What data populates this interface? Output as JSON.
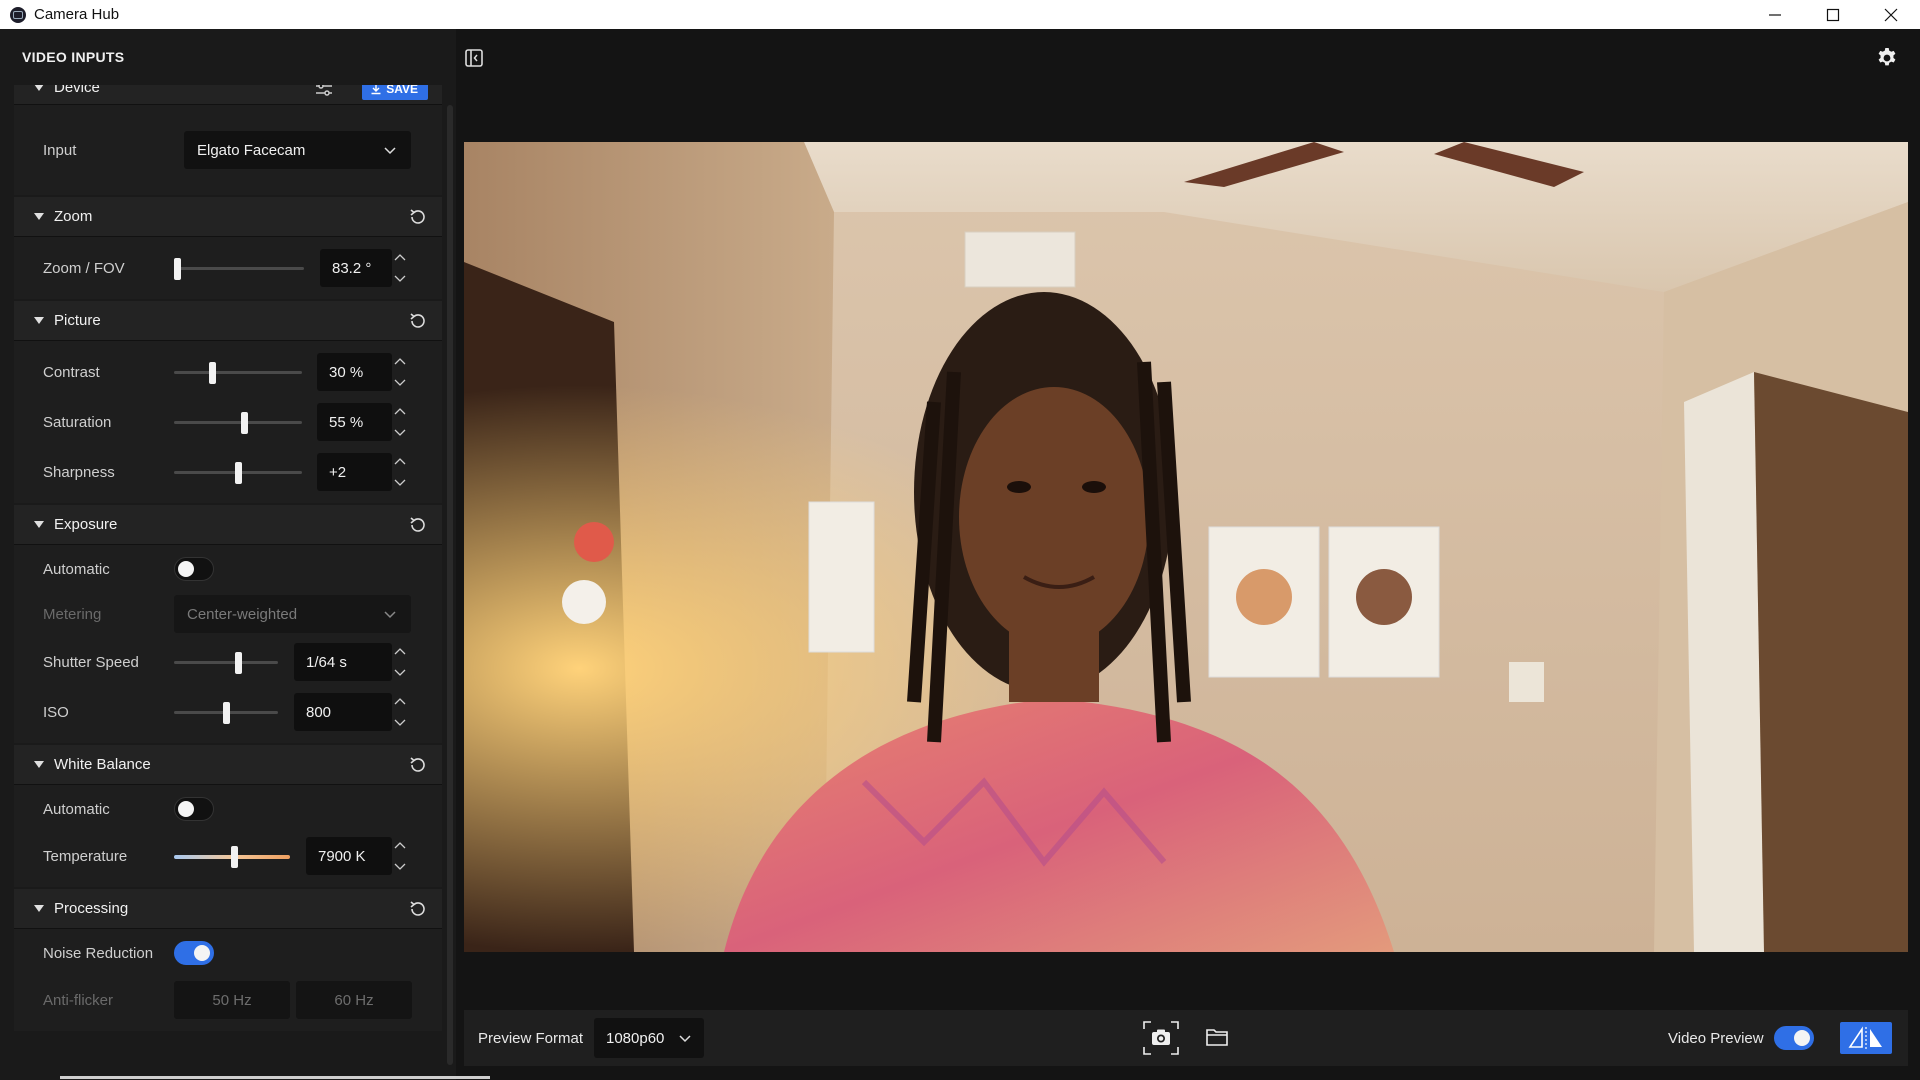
{
  "window": {
    "title": "Camera Hub",
    "icon": "camera-hub-icon"
  },
  "sidebar": {
    "heading": "VIDEO INPUTS",
    "device": {
      "title": "Device",
      "save_label": "SAVE",
      "input_label": "Input",
      "input_value": "Elgato Facecam"
    },
    "zoom": {
      "title": "Zoom",
      "fov_label": "Zoom / FOV",
      "fov_value": "83.2 °",
      "fov_level": 0.02
    },
    "picture": {
      "title": "Picture",
      "contrast_label": "Contrast",
      "contrast_value": "30 %",
      "contrast_level": 0.3,
      "saturation_label": "Saturation",
      "saturation_value": "55 %",
      "saturation_level": 0.55,
      "sharpness_label": "Sharpness",
      "sharpness_value": "+2",
      "sharpness_level": 0.5
    },
    "exposure": {
      "title": "Exposure",
      "auto_label": "Automatic",
      "auto_on": false,
      "metering_label": "Metering",
      "metering_value": "Center-weighted",
      "shutter_label": "Shutter Speed",
      "shutter_value": "1/64 s",
      "shutter_level": 0.62,
      "iso_label": "ISO",
      "iso_value": "800",
      "iso_level": 0.5
    },
    "white_balance": {
      "title": "White Balance",
      "auto_label": "Automatic",
      "auto_on": false,
      "temp_label": "Temperature",
      "temp_value": "7900 K",
      "temp_level": 0.52
    },
    "processing": {
      "title": "Processing",
      "noise_label": "Noise Reduction",
      "noise_on": true,
      "flicker_label": "Anti-flicker",
      "flicker_50": "50 Hz",
      "flicker_60": "60 Hz"
    }
  },
  "bottom": {
    "format_label": "Preview Format",
    "format_value": "1080p60",
    "video_preview_label": "Video Preview",
    "video_preview_on": true
  },
  "colors": {
    "accent": "#2f6fe6",
    "background": "#141414",
    "panel": "#1e1e1e"
  }
}
